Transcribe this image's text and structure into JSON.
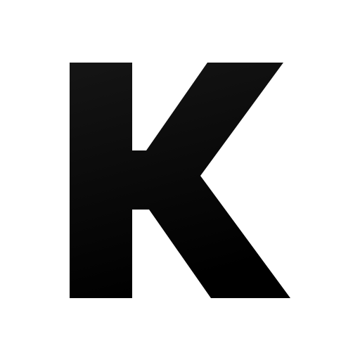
{
  "icon": {
    "name": "letter-k-icon",
    "letter": "K",
    "fill_top": "#151515",
    "fill_bottom": "#000000",
    "background": "#ffffff"
  }
}
